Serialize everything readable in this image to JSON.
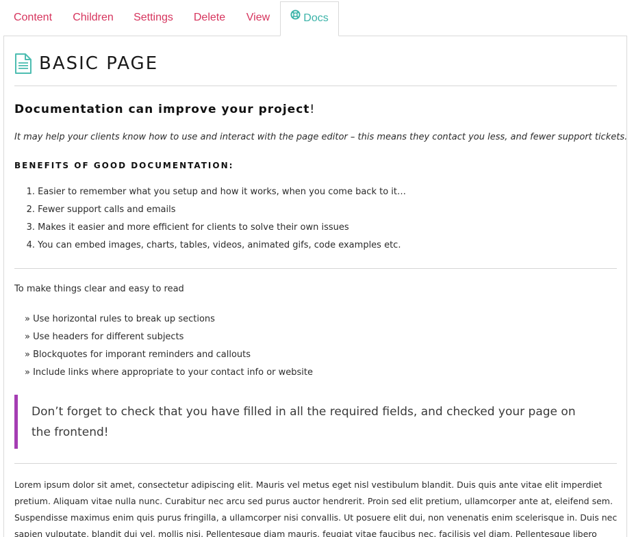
{
  "tabs": [
    {
      "label": "Content"
    },
    {
      "label": "Children"
    },
    {
      "label": "Settings"
    },
    {
      "label": "Delete"
    },
    {
      "label": "View"
    },
    {
      "label": "Docs"
    }
  ],
  "colors": {
    "tab_link": "#d6345d",
    "tab_active": "#3bb3a8",
    "blockquote_border": "#a53db3",
    "rule": "#d6d6d6"
  },
  "icons": {
    "docs_tab": "lifebuoy-icon",
    "page_header": "document-icon"
  },
  "page": {
    "title": "BASIC PAGE"
  },
  "docs": {
    "heading": "Documentation can improve your project",
    "heading_suffix": "!",
    "intro": "It may help your clients know how to use and interact with the page editor – this means they contact you less, and fewer support tickets.",
    "benefits_heading": "BENEFITS OF GOOD DOCUMENTATION:",
    "benefits": [
      {
        "num": "1.",
        "text": "Easier to remember what you setup and how it works, when you come back to it…"
      },
      {
        "num": "2.",
        "text": "Fewer support calls and emails"
      },
      {
        "num": "3.",
        "text": "Makes it easier and more efficient for clients to solve their own issues"
      },
      {
        "num": "4.",
        "text": "You can embed images, charts, tables, videos, animated gifs, code examples etc."
      }
    ],
    "tips_intro": "To make things clear and easy to read",
    "tips": [
      {
        "text": "» Use horizontal rules to break up sections"
      },
      {
        "text": "» Use headers for different subjects"
      },
      {
        "text": "» Blockquotes for imporant reminders and callouts"
      },
      {
        "text": "» Include links where appropriate to your contact info or website"
      }
    ],
    "blockquote": "Don’t forget to check that you have filled in all the required fields, and checked your page on the frontend!",
    "lorem": "Lorem ipsum dolor sit amet, consectetur adipiscing elit. Mauris vel metus eget nisl vestibulum blandit. Duis quis ante vitae elit imperdiet pretium. Aliquam vitae nulla nunc. Curabitur nec arcu sed purus auctor hendrerit. Proin sed elit pretium, ullamcorper ante at, eleifend sem. Suspendisse maximus enim quis purus fringilla, a ullamcorper nisi convallis. Ut posuere elit dui, non venenatis enim scelerisque in. Duis nec sapien vulputate, blandit dui vel, mollis nisi. Pellentesque diam mauris, feugiat vitae faucibus nec, facilisis vel diam. Pellentesque libero tellus, varius vel euismod"
  }
}
